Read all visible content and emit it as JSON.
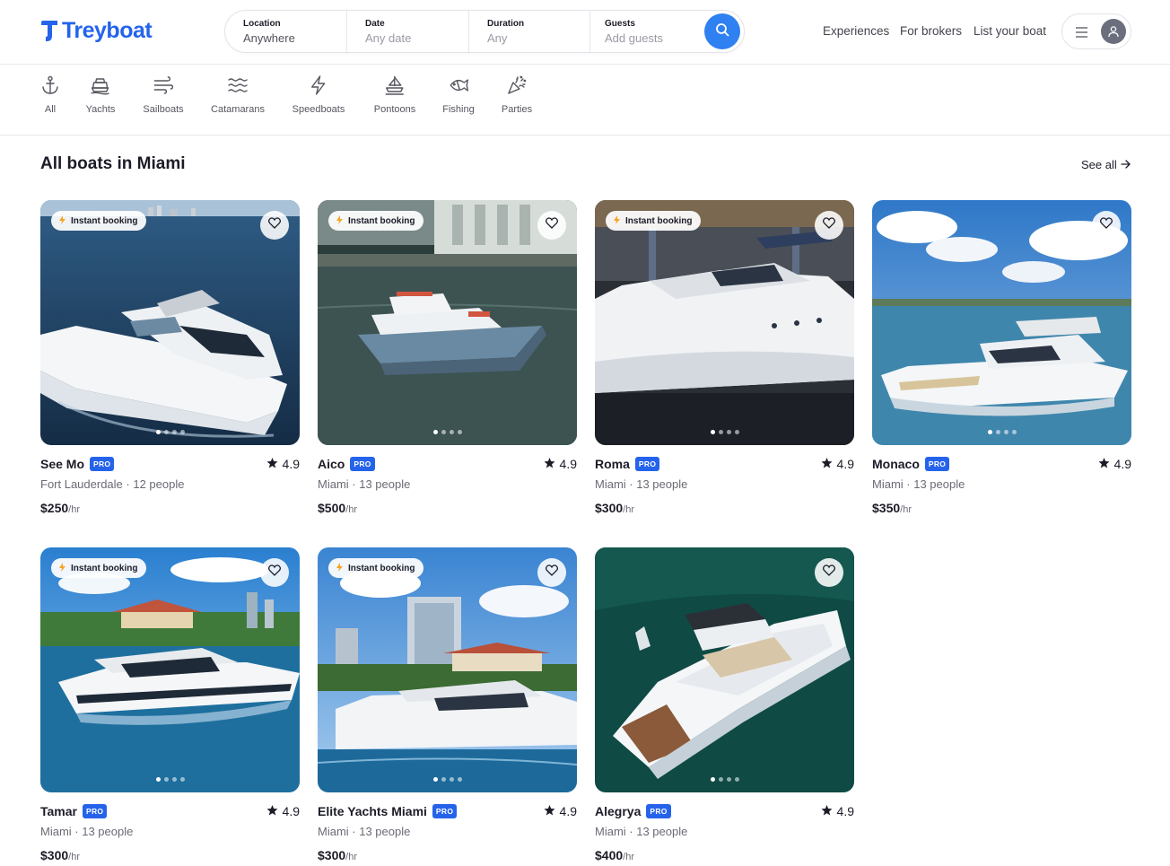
{
  "brand": {
    "name": "Treyboat",
    "color": "#2563eb"
  },
  "search": {
    "location": {
      "label": "Location",
      "value": "Anywhere"
    },
    "date": {
      "label": "Date",
      "placeholder": "Any date"
    },
    "duration": {
      "label": "Duration",
      "placeholder": "Any"
    },
    "guests": {
      "label": "Guests",
      "placeholder": "Add guests"
    },
    "button_icon": "search-icon"
  },
  "nav": {
    "experiences": "Experiences",
    "brokers": "For brokers",
    "list_boat": "List your boat"
  },
  "user_menu": {
    "menu_icon": "hamburger-icon",
    "avatar_icon": "user-icon"
  },
  "categories": [
    {
      "label": "All",
      "icon": "anchor-icon"
    },
    {
      "label": "Yachts",
      "icon": "yacht-icon"
    },
    {
      "label": "Sailboats",
      "icon": "wind-icon"
    },
    {
      "label": "Catamarans",
      "icon": "waves-icon"
    },
    {
      "label": "Speedboats",
      "icon": "lightning-icon"
    },
    {
      "label": "Pontoons",
      "icon": "pontoon-icon"
    },
    {
      "label": "Fishing",
      "icon": "fish-icon"
    },
    {
      "label": "Parties",
      "icon": "party-popper-icon"
    }
  ],
  "section": {
    "title": "All boats in Miami",
    "see_all": "See all"
  },
  "badges": {
    "instant": "Instant booking",
    "pro": "PRO"
  },
  "listings": [
    {
      "name": "See Mo",
      "rating": "4.9",
      "subtitle": "Fort Lauderdale · 12 people",
      "price": "$250",
      "unit": "/hr",
      "instant": true
    },
    {
      "name": "Aico",
      "rating": "4.9",
      "subtitle": "Miami · 13 people",
      "price": "$500",
      "unit": "/hr",
      "instant": true
    },
    {
      "name": "Roma",
      "rating": "4.9",
      "subtitle": "Miami · 13 people",
      "price": "$300",
      "unit": "/hr",
      "instant": true
    },
    {
      "name": "Monaco",
      "rating": "4.9",
      "subtitle": "Miami · 13 people",
      "price": "$350",
      "unit": "/hr",
      "instant": false
    },
    {
      "name": "Tamar",
      "rating": "4.9",
      "subtitle": "Miami · 13 people",
      "price": "$300",
      "unit": "/hr",
      "instant": true
    },
    {
      "name": "Elite Yachts Miami",
      "rating": "4.9",
      "subtitle": "Miami · 13 people",
      "price": "$300",
      "unit": "/hr",
      "instant": true
    },
    {
      "name": "Alegrya",
      "rating": "4.9",
      "subtitle": "Miami · 13 people",
      "price": "$400",
      "unit": "/hr",
      "instant": false
    }
  ]
}
